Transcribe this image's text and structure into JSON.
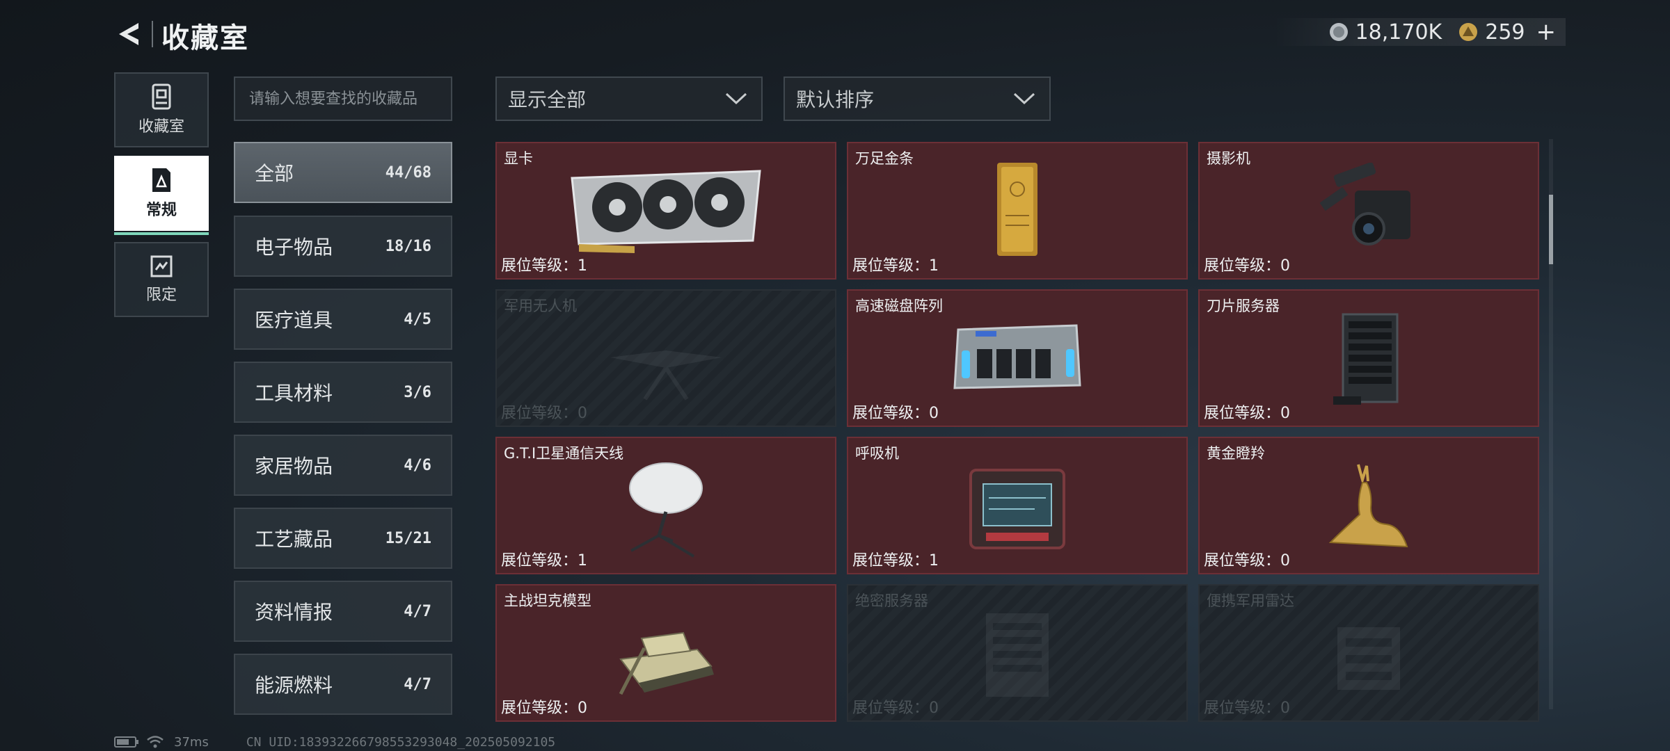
{
  "header": {
    "title": "收藏室",
    "currency_silver": "18,170K",
    "currency_gold": "259",
    "plus_label": "+"
  },
  "side_tabs": [
    {
      "label": "收藏室",
      "icon": "collection-icon",
      "active": false
    },
    {
      "label": "常规",
      "icon": "regular-icon",
      "active": true
    },
    {
      "label": "限定",
      "icon": "limited-icon",
      "active": false
    }
  ],
  "search": {
    "placeholder": "请输入想要查找的收藏品"
  },
  "categories": [
    {
      "name": "全部",
      "count": "44/68"
    },
    {
      "name": "电子物品",
      "count": "18/16"
    },
    {
      "name": "医疗道具",
      "count": "4/5"
    },
    {
      "name": "工具材料",
      "count": "3/6"
    },
    {
      "name": "家居物品",
      "count": "4/6"
    },
    {
      "name": "工艺藏品",
      "count": "15/21"
    },
    {
      "name": "资料情报",
      "count": "4/7"
    },
    {
      "name": "能源燃料",
      "count": "4/7"
    }
  ],
  "filters": {
    "filter_label": "显示全部",
    "sort_label": "默认排序"
  },
  "level_prefix": "展位等级：",
  "items": [
    {
      "name": "显卡",
      "level": "1",
      "locked": false,
      "icon": "gpu-icon"
    },
    {
      "name": "万足金条",
      "level": "1",
      "locked": false,
      "icon": "gold-bar-icon"
    },
    {
      "name": "摄影机",
      "level": "0",
      "locked": false,
      "icon": "camera-icon"
    },
    {
      "name": "军用无人机",
      "level": "0",
      "locked": true,
      "icon": "drone-icon"
    },
    {
      "name": "高速磁盘阵列",
      "level": "0",
      "locked": false,
      "icon": "disk-array-icon"
    },
    {
      "name": "刀片服务器",
      "level": "0",
      "locked": false,
      "icon": "blade-server-icon"
    },
    {
      "name": "G.T.I卫星通信天线",
      "level": "1",
      "locked": false,
      "icon": "satellite-dish-icon"
    },
    {
      "name": "呼吸机",
      "level": "1",
      "locked": false,
      "icon": "ventilator-icon"
    },
    {
      "name": "黄金瞪羚",
      "level": "0",
      "locked": false,
      "icon": "gold-gazelle-icon"
    },
    {
      "name": "主战坦克模型",
      "level": "0",
      "locked": false,
      "icon": "tank-model-icon"
    },
    {
      "name": "绝密服务器",
      "level": "0",
      "locked": true,
      "icon": "secret-server-icon"
    },
    {
      "name": "便携军用雷达",
      "level": "0",
      "locked": true,
      "icon": "radar-icon"
    }
  ],
  "footer": {
    "ping": "37ms",
    "uid": "CN UID:1839322667985532930​48_202505092105"
  }
}
